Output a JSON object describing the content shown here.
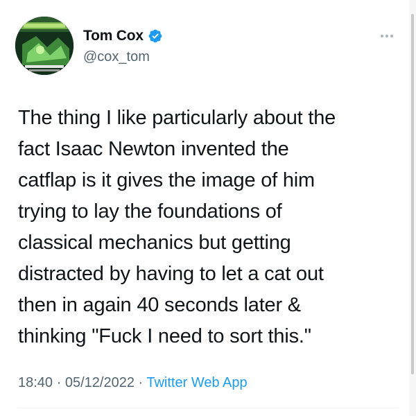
{
  "author": {
    "display_name": "Tom Cox",
    "handle": "@cox_tom",
    "verified": true,
    "avatar_icon": "village-magazine-avatar"
  },
  "tweet": {
    "text": "The thing I like particularly about the\nfact Isaac Newton invented the\ncatflap is it gives the image of him\ntrying to lay the foundations of\nclassical mechanics but getting\ndistracted by having to let a cat out\nthen in again 40 seconds later &\nthinking \"Fuck I need to sort this.\""
  },
  "meta": {
    "time": "18:40",
    "date": "05/12/2022",
    "separator": "·",
    "source": "Twitter Web App"
  },
  "colors": {
    "text": "#0f1419",
    "secondary": "#536471",
    "link": "#1d9bf0",
    "verified": "#1d9bf0"
  },
  "icons": {
    "verified": "verified-badge-icon",
    "more": "more-options-icon"
  }
}
